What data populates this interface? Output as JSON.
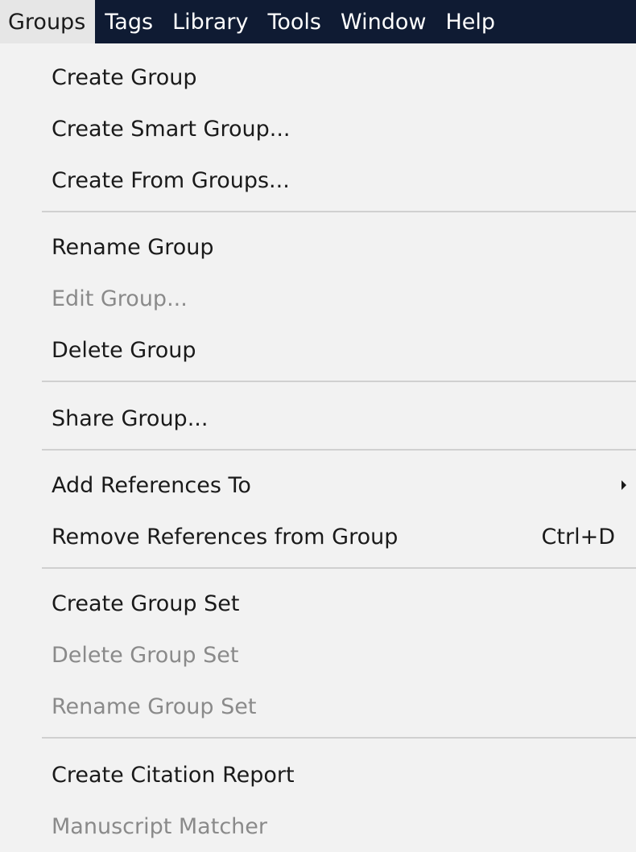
{
  "menubar": {
    "items": [
      {
        "label": "Groups"
      },
      {
        "label": "Tags"
      },
      {
        "label": "Library"
      },
      {
        "label": "Tools"
      },
      {
        "label": "Window"
      },
      {
        "label": "Help"
      }
    ],
    "active": "Groups"
  },
  "menu": {
    "items": [
      {
        "label": "Create Group",
        "enabled": true
      },
      {
        "label": "Create Smart Group...",
        "enabled": true
      },
      {
        "label": "Create From Groups...",
        "enabled": true
      },
      {
        "label": "Rename Group",
        "enabled": true
      },
      {
        "label": "Edit Group...",
        "enabled": false
      },
      {
        "label": "Delete Group",
        "enabled": true
      },
      {
        "label": "Share Group...",
        "enabled": true
      },
      {
        "label": "Add References To",
        "enabled": true,
        "submenu": true
      },
      {
        "label": "Remove References from Group",
        "enabled": true,
        "shortcut": "Ctrl+D"
      },
      {
        "label": "Create Group Set",
        "enabled": true
      },
      {
        "label": "Delete Group Set",
        "enabled": false
      },
      {
        "label": "Rename Group Set",
        "enabled": false
      },
      {
        "label": "Create Citation Report",
        "enabled": true
      },
      {
        "label": "Manuscript Matcher",
        "enabled": false
      }
    ]
  },
  "colors": {
    "menubar_bg": "#0f1b33",
    "active_menu_bg": "#e6e6e6",
    "menu_bg": "#f2f2f2",
    "disabled_text": "#8a8a8a"
  }
}
